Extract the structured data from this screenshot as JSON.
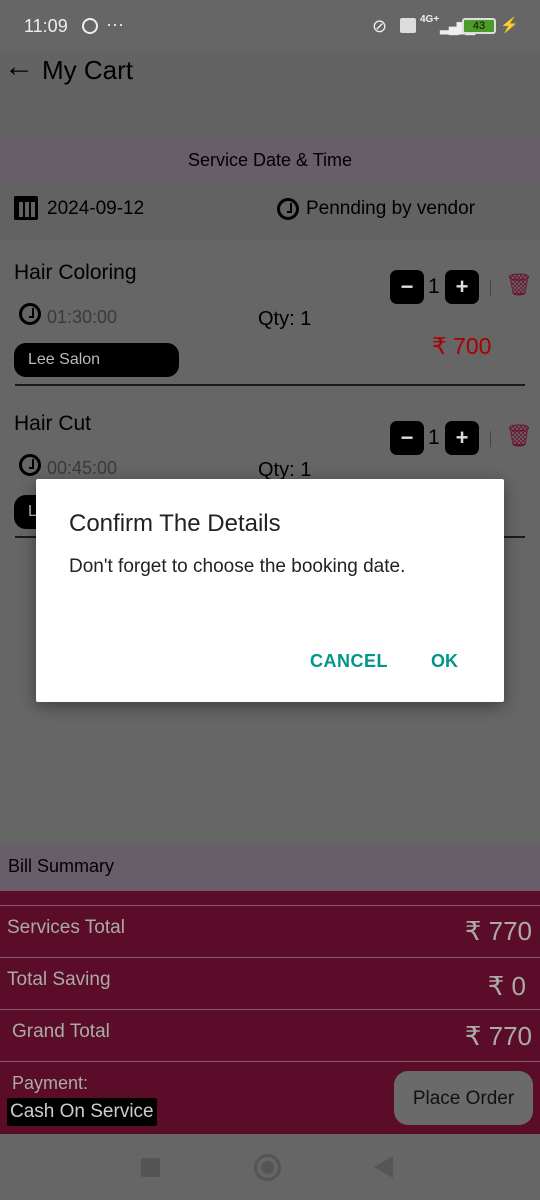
{
  "status_bar": {
    "time": "11:09",
    "dots": "···",
    "network": "4G+",
    "battery": "43"
  },
  "header": {
    "title": "My Cart"
  },
  "service_section": {
    "title": "Service Date & Time",
    "date": "2024-09-12",
    "status": "Pennding by vendor"
  },
  "cart_items": [
    {
      "name": "Hair Coloring",
      "duration": "01:30:00",
      "qty_label": "Qty: 1",
      "qty": "1",
      "vendor": "Lee Salon",
      "price": "₹ 700"
    },
    {
      "name": "Hair Cut",
      "duration": "00:45:00",
      "qty_label": "Qty: 1",
      "qty": "1",
      "vendor": "L"
    }
  ],
  "dialog": {
    "title": "Confirm The Details",
    "message": "Don't forget to choose the booking date.",
    "cancel": "CANCEL",
    "ok": "OK"
  },
  "bill": {
    "title": "Bill Summary",
    "rows": [
      {
        "label": "Services Total",
        "value": "₹ 770"
      },
      {
        "label": "Total Saving",
        "value": "₹ 0"
      },
      {
        "label": "Grand Total",
        "value": "₹ 770"
      }
    ],
    "payment_label": "Payment:",
    "payment_method": "Cash On Service",
    "place_order": "Place Order"
  },
  "colors": {
    "accent": "#009688",
    "brand": "#8b1538",
    "price": "#c00000"
  }
}
